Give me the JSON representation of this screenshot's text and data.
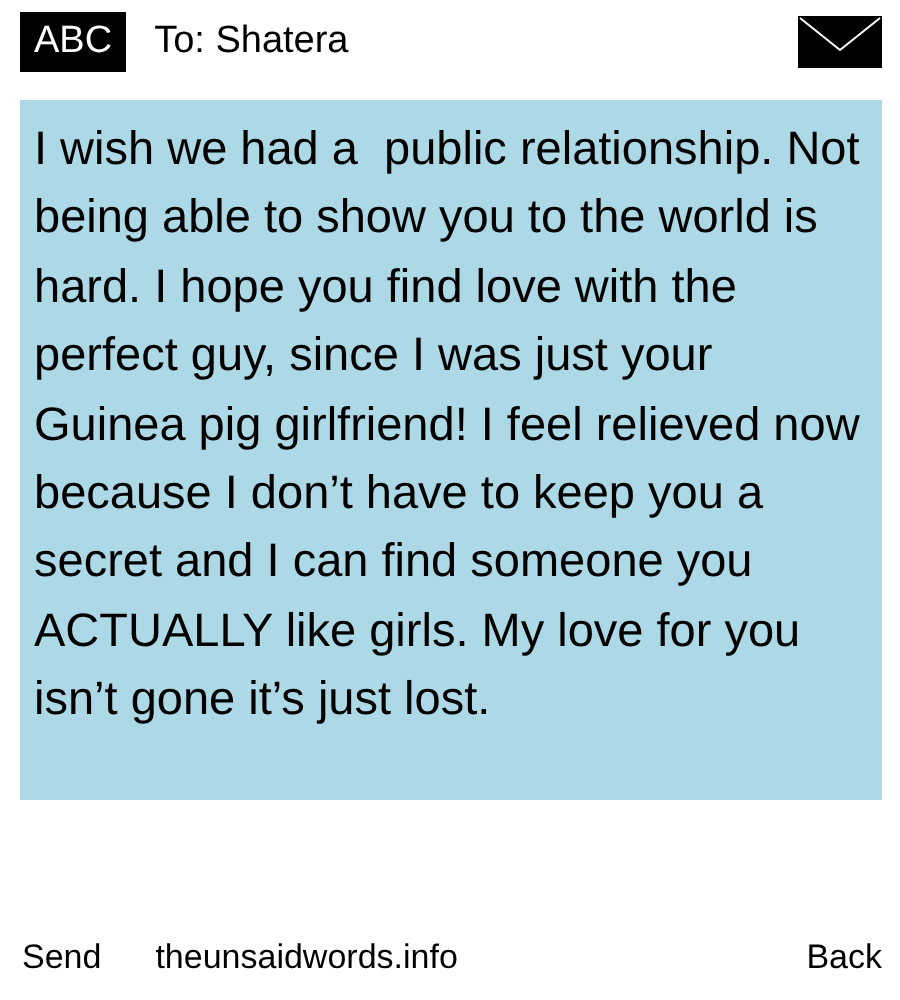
{
  "header": {
    "input_mode": "ABC",
    "recipient": "To: Shatera"
  },
  "message": {
    "text": "I wish we had a  public relationship. Not being able to show you to the world is hard. I hope you find love with the perfect guy, since I was just your Guinea pig girlfriend! I feel relieved now because I don’t have to keep you a secret and I can find someone you ACTUALLY like girls. My love for you isn’t gone it’s just lost."
  },
  "softkeys": {
    "left": "Send",
    "center": "theunsaidwords.info",
    "right": "Back"
  }
}
